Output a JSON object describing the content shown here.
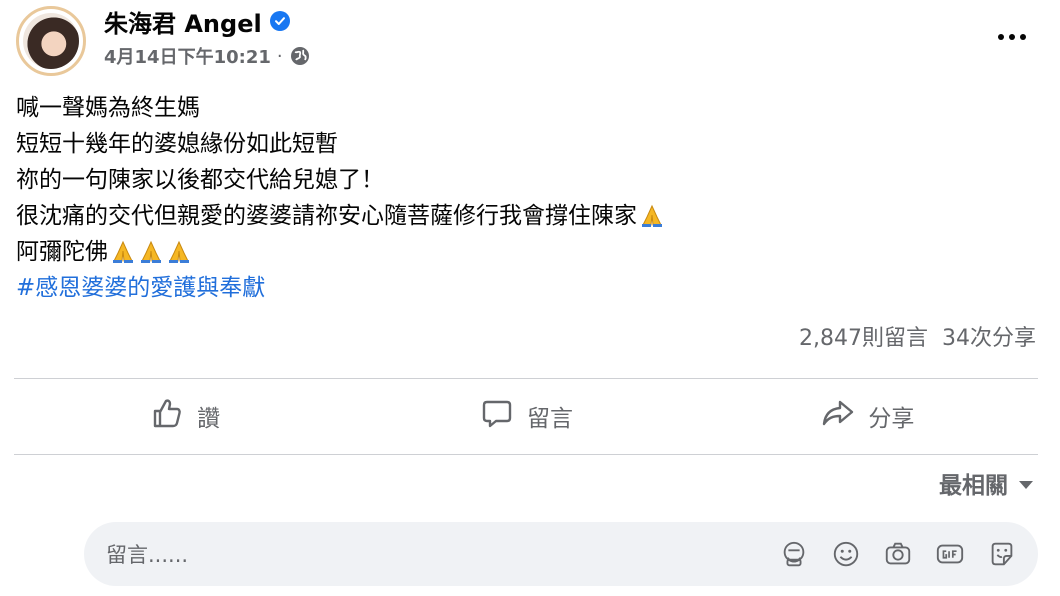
{
  "author": {
    "name": "朱海君 Angel",
    "verified": true,
    "timestamp": "4月14日下午10:21",
    "separator": "·",
    "privacy_icon": "globe-icon"
  },
  "post": {
    "lines": [
      "喊一聲媽為終生媽",
      "短短十幾年的婆媳緣份如此短暫",
      "祢的一句陳家以後都交代給兒媳了！",
      "很沈痛的交代但親愛的婆婆請祢安心隨菩薩修行我會撐住陳家",
      "阿彌陀佛"
    ],
    "hashtag": "#感恩婆婆的愛護與奉獻"
  },
  "stats": {
    "comments": "2,847則留言",
    "shares": "34次分享"
  },
  "actions": {
    "like": "讚",
    "comment": "留言",
    "share": "分享"
  },
  "sort": {
    "label": "最相關"
  },
  "comment_box": {
    "placeholder": "留言......"
  },
  "colors": {
    "accent": "#1877f2",
    "hashtag": "#216fdb",
    "secondary_text": "#65676b",
    "divider": "#ced0d4",
    "input_bg": "#f0f2f5"
  }
}
